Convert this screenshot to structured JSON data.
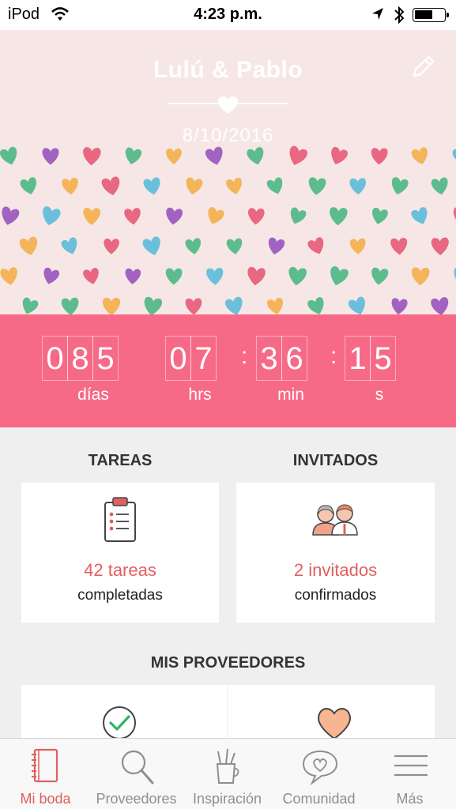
{
  "status_bar": {
    "carrier": "iPod",
    "time": "4:23 p.m."
  },
  "header": {
    "couple_names": "Lulú & Pablo",
    "wedding_date": "8/10/2016"
  },
  "countdown": {
    "days": [
      "0",
      "8",
      "5"
    ],
    "hours": [
      "0",
      "7"
    ],
    "minutes": [
      "3",
      "6"
    ],
    "seconds": [
      "1",
      "5"
    ],
    "labels": {
      "days": "días",
      "hours": "hrs",
      "minutes": "min",
      "seconds": "s"
    }
  },
  "tasks": {
    "title": "TAREAS",
    "count": "42 tareas",
    "subtitle": "completadas"
  },
  "guests": {
    "title": "INVITADOS",
    "count": "2 invitados",
    "subtitle": "confirmados"
  },
  "vendors": {
    "title": "MIS PROVEEDORES"
  },
  "tabbar": {
    "items": [
      {
        "label": "Mi boda",
        "icon": "notebook-icon"
      },
      {
        "label": "Proveedores",
        "icon": "search-icon"
      },
      {
        "label": "Inspiración",
        "icon": "pencil-cup-icon"
      },
      {
        "label": "Comunidad",
        "icon": "heart-bubble-icon"
      },
      {
        "label": "Más",
        "icon": "hamburger-menu-icon"
      }
    ]
  },
  "colors": {
    "accent": "#f76a87",
    "hero_background": "#f6e7e6",
    "highlight_text": "#e06060",
    "active_tab": "#e0605f"
  }
}
